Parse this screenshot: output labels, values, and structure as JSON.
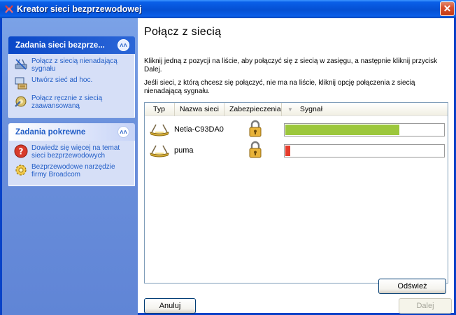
{
  "window": {
    "title": "Kreator sieci bezprzewodowej",
    "close_glyph": "✕"
  },
  "tasks_network": {
    "title": "Zadania sieci bezprze...",
    "items": [
      {
        "label": "Połącz z siecią nienadającą sygnału",
        "icon": "hidden-network-icon"
      },
      {
        "label": "Utwórz sieć ad hoc.",
        "icon": "adhoc-network-icon"
      },
      {
        "label": "Połącz ręcznie z siecią zaawansowaną",
        "icon": "advanced-network-icon"
      }
    ]
  },
  "tasks_related": {
    "title": "Zadania pokrewne",
    "items": [
      {
        "label": "Dowiedz się więcej na temat sieci bezprzewodowych",
        "icon": "help-icon"
      },
      {
        "label": "Bezprzewodowe narzędzie firmy Broadcom",
        "icon": "broadcom-tool-icon"
      }
    ]
  },
  "main": {
    "heading": "Połącz z siecią",
    "instruction1": "Kliknij jedną z pozycji na liście, aby połączyć się z siecią w zasięgu, a następnie kliknij przycisk Dalej.",
    "instruction2": "Jeśli sieci, z którą chcesz się połączyć, nie ma na liście, kliknij opcję połączenia z siecią nienadającą sygnału."
  },
  "table": {
    "columns": [
      "Typ",
      "Nazwa sieci",
      "Zabezpieczenia",
      "Sygnał"
    ],
    "rows": [
      {
        "name": "Netia-C93DA0",
        "secured": true,
        "signal": 0.72,
        "signal_color": "#9cc73c"
      },
      {
        "name": "puma",
        "secured": true,
        "signal": 0.03,
        "signal_color": "#e53c2c"
      }
    ]
  },
  "buttons": {
    "refresh": "Odśwież",
    "cancel": "Anuluj",
    "next": "Dalej"
  },
  "colors": {
    "title_bar": "#0653d8",
    "left_pane": "#6a8fdb",
    "link": "#215dc6"
  }
}
